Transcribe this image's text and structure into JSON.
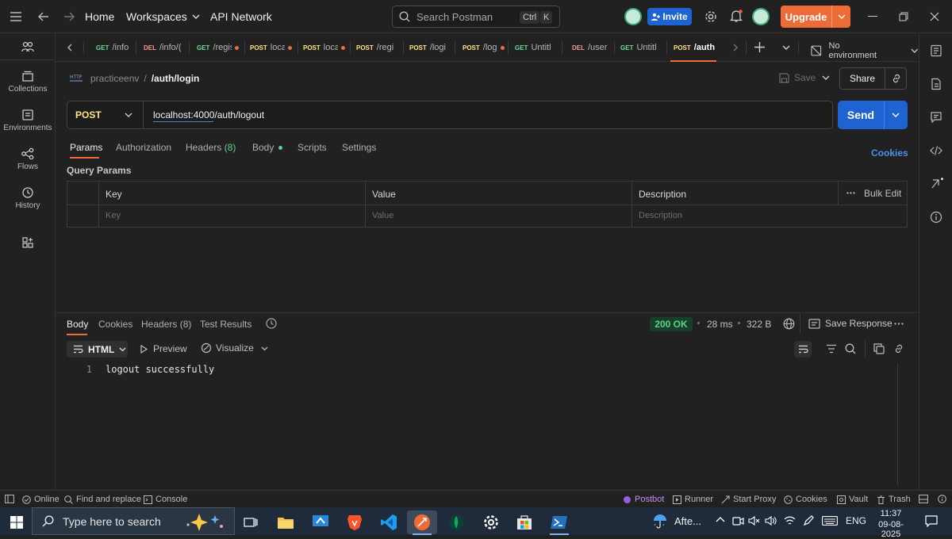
{
  "topbar": {
    "home": "Home",
    "workspaces": "Workspaces",
    "api_network": "API Network",
    "search_placeholder": "Search Postman",
    "kbd_ctrl": "Ctrl",
    "kbd_k": "K",
    "invite": "Invite",
    "upgrade": "Upgrade"
  },
  "sidebar": {
    "items": [
      {
        "label": "Collections",
        "icon": "collections-icon"
      },
      {
        "label": "Environments",
        "icon": "environments-icon"
      },
      {
        "label": "Flows",
        "icon": "flows-icon"
      },
      {
        "label": "History",
        "icon": "history-icon"
      }
    ]
  },
  "tabs": {
    "items": [
      {
        "method": "GET",
        "name": "/info",
        "unsaved": false
      },
      {
        "method": "DEL",
        "name": "/info/(",
        "unsaved": false
      },
      {
        "method": "GET",
        "name": "/regis",
        "unsaved": true
      },
      {
        "method": "POST",
        "name": "loca",
        "unsaved": true
      },
      {
        "method": "POST",
        "name": "loca",
        "unsaved": true
      },
      {
        "method": "POST",
        "name": "/regi",
        "unsaved": false
      },
      {
        "method": "POST",
        "name": "/logi",
        "unsaved": false
      },
      {
        "method": "POST",
        "name": "/log",
        "unsaved": true
      },
      {
        "method": "GET",
        "name": "Untitl",
        "unsaved": false
      },
      {
        "method": "DEL",
        "name": "/user",
        "unsaved": false
      },
      {
        "method": "GET",
        "name": "Untitl",
        "unsaved": false
      },
      {
        "method": "POST",
        "name": "/auth",
        "unsaved": false,
        "active": true
      }
    ],
    "environment": "No environment"
  },
  "request": {
    "breadcrumb_collection": "practiceenv",
    "breadcrumb_sep": "/",
    "breadcrumb_name": "/auth/login",
    "save": "Save",
    "share": "Share",
    "method": "POST",
    "url": "localhost:4000/auth/logout",
    "send": "Send",
    "subtabs": {
      "params": "Params",
      "authorization": "Authorization",
      "headers": "Headers",
      "headers_count": "(8)",
      "body": "Body",
      "scripts": "Scripts",
      "settings": "Settings"
    },
    "cookies": "Cookies",
    "query_params_title": "Query Params",
    "table": {
      "columns": [
        "Key",
        "Value",
        "Description"
      ],
      "bulk_edit": "Bulk Edit",
      "placeholders": [
        "Key",
        "Value",
        "Description"
      ]
    }
  },
  "response": {
    "tabs": {
      "body": "Body",
      "cookies": "Cookies",
      "headers": "Headers (8)",
      "test_results": "Test Results"
    },
    "status": "200 OK",
    "time": "28 ms",
    "size": "322 B",
    "save_response": "Save Response",
    "format": "HTML",
    "preview": "Preview",
    "visualize": "Visualize",
    "lines": [
      {
        "num": "1",
        "text": "logout successfully"
      }
    ]
  },
  "footer": {
    "online": "Online",
    "find_replace": "Find and replace",
    "console": "Console",
    "postbot": "Postbot",
    "runner": "Runner",
    "start_proxy": "Start Proxy",
    "cookies": "Cookies",
    "vault": "Vault",
    "trash": "Trash"
  },
  "taskbar": {
    "search_placeholder": "Type here to search",
    "weather": "Afte...",
    "language": "ENG",
    "time": "11:37",
    "date": "09-08-2025"
  },
  "colors": {
    "accent_orange": "#ec6b36",
    "send_blue": "#1f62d1",
    "get_green": "#6bdd9a",
    "post_yellow": "#ffe47e",
    "delete_red": "#f79a8e",
    "status_green": "#5ad28d"
  }
}
